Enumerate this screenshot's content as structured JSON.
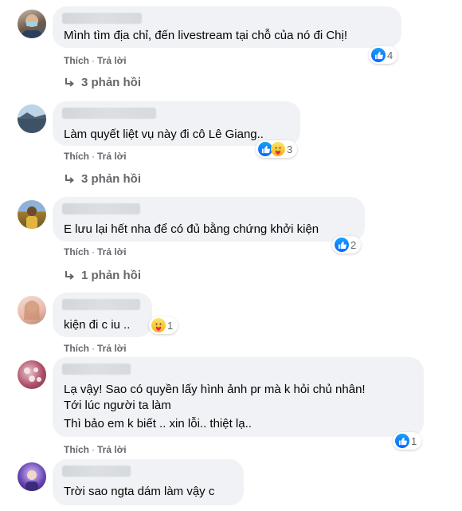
{
  "comments": [
    {
      "text_lines": [
        "Mình tìm địa chỉ, đến livestream tại chỗ của nó đi Chị!"
      ],
      "like_label": "Thích",
      "reply_label": "Trả lời",
      "reaction_count": "4",
      "reactions": [
        "like"
      ],
      "replies_label": "3 phản hồi"
    },
    {
      "text_lines": [
        "Làm quyết liệt vụ này đi cô Lê Giang.."
      ],
      "like_label": "Thích",
      "reply_label": "Trả lời",
      "reaction_count": "3",
      "reactions": [
        "like",
        "care"
      ],
      "replies_label": "3 phản hồi"
    },
    {
      "text_lines": [
        "E lưu lại hết nha để có đủ bằng chứng khởi kiện"
      ],
      "like_label": "Thích",
      "reply_label": "Trả lời",
      "reaction_count": "2",
      "reactions": [
        "like"
      ],
      "replies_label": "1 phản hồi"
    },
    {
      "text_lines": [
        "kiện đi c iu .."
      ],
      "like_label": "Thích",
      "reply_label": "Trả lời",
      "reaction_count": "1",
      "reactions": [
        "care"
      ]
    },
    {
      "text_lines": [
        "Lạ vậy! Sao có quyền lấy hình ảnh pr mà k hỏi chủ nhân!",
        "Tới lúc người ta làm",
        "Thì bảo em k biết .. xin lỗi.. thiệt lạ.."
      ],
      "like_label": "Thích",
      "reply_label": "Trả lời",
      "reaction_count": "1",
      "reactions": [
        "like"
      ]
    },
    {
      "text_lines": [
        "Trời sao ngta dám làm vậy c"
      ]
    }
  ],
  "colors": {
    "bubble": "#f0f2f5",
    "meta_text": "#65676b",
    "like_blue": "#0866ff"
  }
}
